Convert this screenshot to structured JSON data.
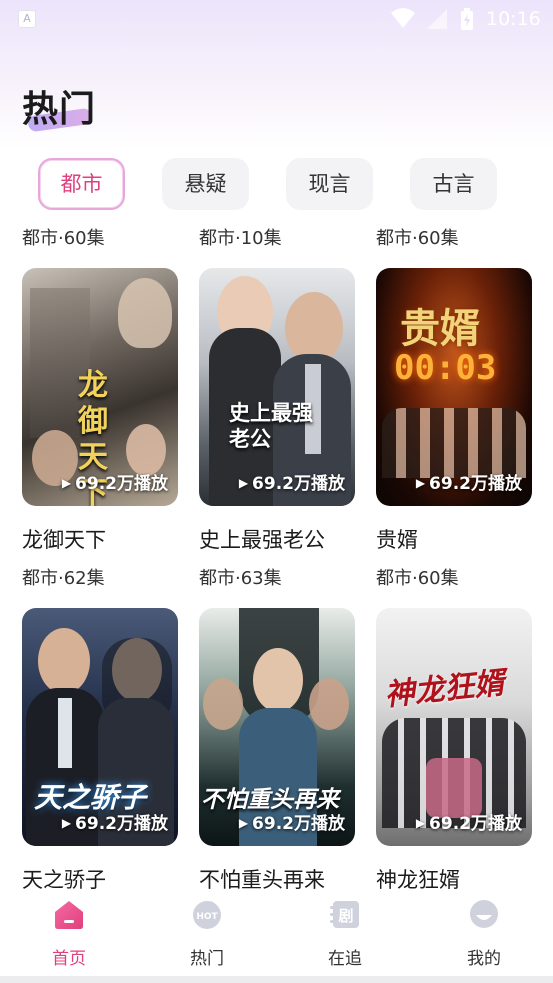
{
  "status_bar": {
    "time": "10:16",
    "left_icon_glyph": "A"
  },
  "header": {
    "title": "热门"
  },
  "tabs": [
    {
      "label": "都市",
      "active": true
    },
    {
      "label": "悬疑",
      "active": false
    },
    {
      "label": "现言",
      "active": false
    },
    {
      "label": "古言",
      "active": false
    }
  ],
  "top_row_meta": [
    "都市·60集",
    "都市·10集",
    "都市·60集"
  ],
  "cards": [
    {
      "title": "龙御天下",
      "meta": "都市·62集",
      "plays": "69.2万播放",
      "poster_text": "龙御天下"
    },
    {
      "title": "史上最强老公",
      "meta": "都市·63集",
      "plays": "69.2万播放",
      "poster_text": "史上最强老公"
    },
    {
      "title": "贵婿",
      "meta": "都市·60集",
      "plays": "69.2万播放",
      "poster_text": "贵婿",
      "poster_sub": "00:03"
    },
    {
      "title": "天之骄子",
      "meta": "",
      "plays": "69.2万播放",
      "poster_text": "天之骄子"
    },
    {
      "title": "不怕重头再来",
      "meta": "",
      "plays": "69.2万播放",
      "poster_text": "不怕重头再来"
    },
    {
      "title": "神龙狂婿",
      "meta": "",
      "plays": "69.2万播放",
      "poster_text": "神龙狂婿"
    }
  ],
  "bottom_nav": [
    {
      "label": "首页",
      "icon": "home-icon",
      "active": true
    },
    {
      "label": "热门",
      "icon": "hot-icon",
      "active": false,
      "icon_text": "HOT"
    },
    {
      "label": "在追",
      "icon": "drama-icon",
      "active": false,
      "icon_text": "剧"
    },
    {
      "label": "我的",
      "icon": "profile-icon",
      "active": false
    }
  ],
  "colors": {
    "accent": "#e0407e",
    "tab_active_border": "#e6a7de",
    "title_underline": "#b9a3f4"
  }
}
